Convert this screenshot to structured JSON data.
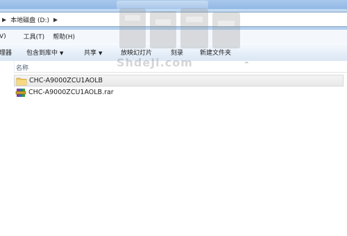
{
  "address": {
    "path": [
      "本地磁盘 (D:)"
    ]
  },
  "menubar": {
    "items": [
      {
        "label": "V)"
      },
      {
        "label": "工具(T)"
      },
      {
        "label": "帮助(H)"
      }
    ]
  },
  "toolbar": {
    "items": [
      {
        "label": "理器",
        "has_dropdown": false
      },
      {
        "label": "包含到库中",
        "has_dropdown": true
      },
      {
        "label": "共享",
        "has_dropdown": true
      },
      {
        "label": "放映幻灯片",
        "has_dropdown": false
      },
      {
        "label": "刻录",
        "has_dropdown": false
      },
      {
        "label": "新建文件夹",
        "has_dropdown": false
      }
    ]
  },
  "column_header": {
    "name_label": "名称"
  },
  "files": [
    {
      "name": "CHC-A9000ZCU1AOLB",
      "icon": "folder-icon",
      "selected": true
    },
    {
      "name": "CHC-A9000ZCU1AOLB.rar",
      "icon": "rar-archive-icon",
      "selected": false
    }
  ],
  "watermark": {
    "text": "ShdeJi.com"
  },
  "colors": {
    "titlebar": "#8fb6e3",
    "toolbar": "#e6eff9",
    "folder": "#f3c866",
    "selection": "#e9e9e9"
  }
}
